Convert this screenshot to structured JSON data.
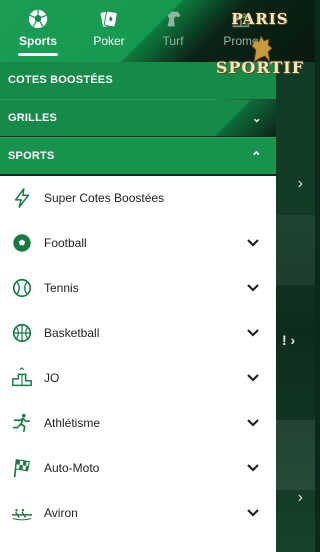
{
  "header": {
    "tabs": [
      {
        "label": "Sports",
        "icon": "soccer-ball-icon",
        "active": true
      },
      {
        "label": "Poker",
        "icon": "playing-cards-icon",
        "active": false
      },
      {
        "label": "Turf",
        "icon": "horse-icon",
        "active": false
      },
      {
        "label": "Promo",
        "icon": "gift-icon",
        "active": false
      }
    ],
    "brand": {
      "line1": "PARIS",
      "line2": "SPORTIF"
    }
  },
  "sections": {
    "cotes": {
      "label": "COTES BOOSTÉES"
    },
    "grilles": {
      "label": "GRILLES"
    },
    "sports": {
      "label": "SPORTS"
    }
  },
  "sports_list": [
    {
      "label": "Super Cotes Boostées",
      "icon": "lightning-icon",
      "has_chevron": false
    },
    {
      "label": "Football",
      "icon": "football-icon",
      "has_chevron": true
    },
    {
      "label": "Tennis",
      "icon": "tennis-ball-icon",
      "has_chevron": true
    },
    {
      "label": "Basketball",
      "icon": "basketball-icon",
      "has_chevron": true
    },
    {
      "label": "JO",
      "icon": "olympic-podium-icon",
      "has_chevron": true
    },
    {
      "label": "Athlétisme",
      "icon": "runner-icon",
      "has_chevron": true
    },
    {
      "label": "Auto-Moto",
      "icon": "checkered-flag-icon",
      "has_chevron": true
    },
    {
      "label": "Aviron",
      "icon": "rowing-icon",
      "has_chevron": true
    }
  ],
  "colors": {
    "accent": "#168a48",
    "icon": "#177a44",
    "header_dark": "#0b2216"
  }
}
